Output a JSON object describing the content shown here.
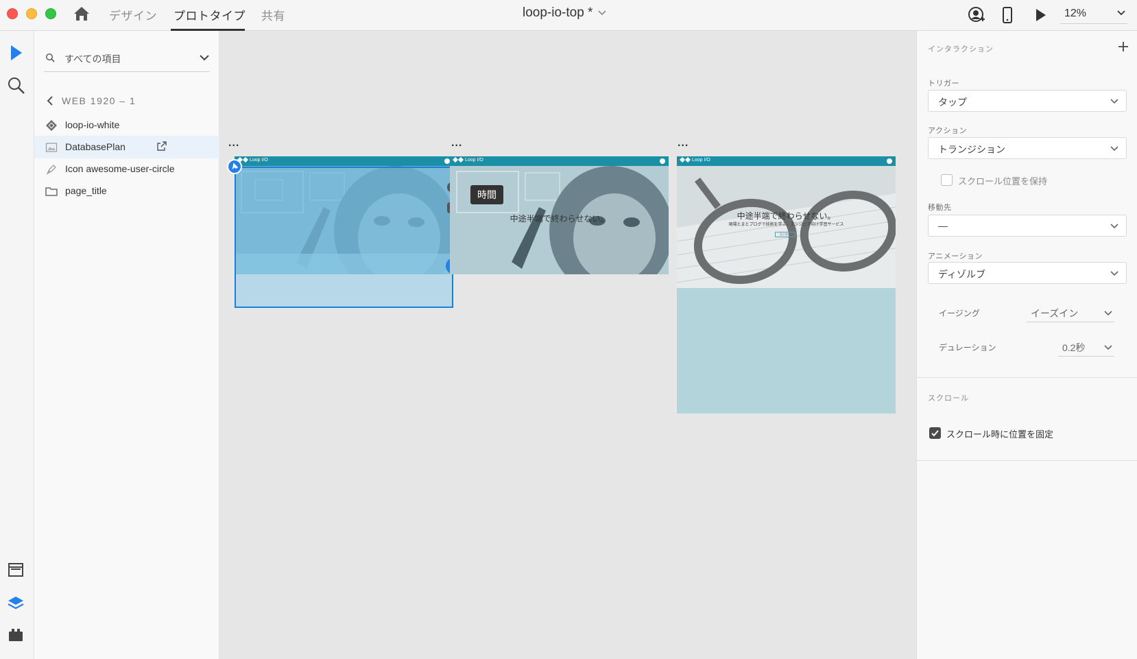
{
  "window": {
    "title": "loop-io-top *",
    "tabs": [
      {
        "label": "デザイン",
        "active": false
      },
      {
        "label": "プロトタイプ",
        "active": true
      },
      {
        "label": "共有",
        "active": false
      }
    ],
    "zoom": "12%"
  },
  "layers": {
    "search_placeholder": "すべての項目",
    "breadcrumb": "WEB 1920 – 1",
    "items": [
      {
        "label": "loop-io-white",
        "icon": "component-icon"
      },
      {
        "label": "DatabasePlan",
        "icon": "image-icon",
        "selected": true
      },
      {
        "label": "Icon awesome-user-circle",
        "icon": "pen-path-icon"
      },
      {
        "label": "page_title",
        "icon": "folder-icon"
      }
    ]
  },
  "canvas": {
    "artboard_menu": "...",
    "time_tag": "時間",
    "artboards": [
      {
        "logo": "Loop I/O",
        "headline": ""
      },
      {
        "logo": "Loop I/O",
        "headline": "中途半端で終わらせない。"
      },
      {
        "logo": "Loop I/O",
        "headline": "中途半端で終わらせない。",
        "subline": "現場とまとブログで技術を学ぶ、エンジニア向け学習サービス",
        "button": "はじめる"
      }
    ]
  },
  "props": {
    "interaction_title": "インタラクション",
    "trigger_label": "トリガー",
    "trigger_value": "タップ",
    "action_label": "アクション",
    "action_value": "トランジション",
    "keep_scroll_label": "スクロール位置を保持",
    "keep_scroll_checked": false,
    "destination_label": "移動先",
    "destination_value": "—",
    "animation_label": "アニメーション",
    "animation_value": "ディゾルブ",
    "easing_label": "イージング",
    "easing_value": "イーズイン",
    "duration_label": "デュレーション",
    "duration_value": "0.2秒",
    "scroll_title": "スクロール",
    "fix_position_label": "スクロール時に位置を固定",
    "fix_position_checked": true
  },
  "colors": {
    "accent": "#2680eb",
    "selection": "#1a7fd8",
    "header_teal": "#1a8fa6",
    "traffic_red": "#fc5753",
    "traffic_yellow": "#fdbc40",
    "traffic_green": "#33c748"
  }
}
